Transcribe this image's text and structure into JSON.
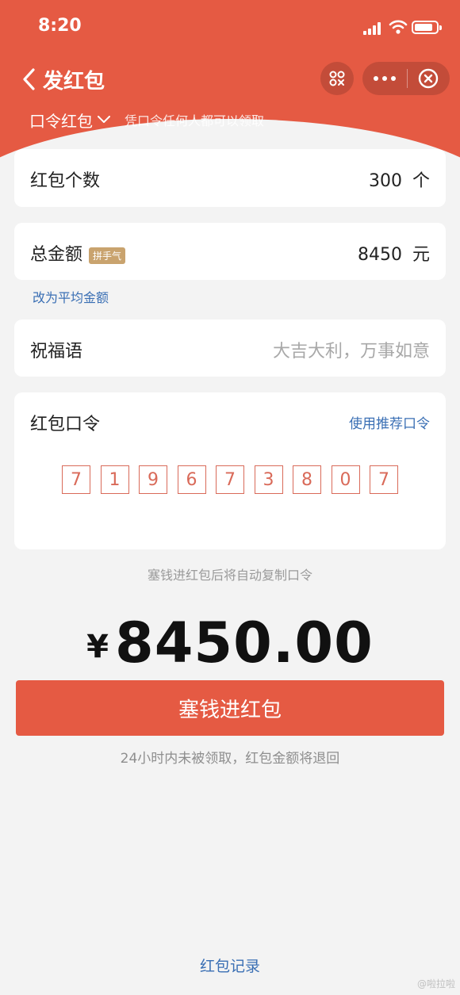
{
  "status_bar": {
    "time": "8:20",
    "icons": [
      "signal-icon",
      "wifi-icon",
      "battery-icon"
    ]
  },
  "nav": {
    "title": "发红包",
    "back_icon": "chevron-left-icon",
    "scan_icon": "scan-icon",
    "more_icon": "more-dots-icon",
    "close_icon": "close-circle-icon"
  },
  "packet_type": {
    "selected": "口令红包",
    "description": "凭口令任何人都可以领取"
  },
  "count_row": {
    "label": "红包个数",
    "value": "300",
    "unit": "个"
  },
  "total_row": {
    "label": "总金额",
    "badge": "拼手气",
    "value": "8450",
    "unit": "元"
  },
  "switch_link": "改为平均金额",
  "greeting_row": {
    "label": "祝福语",
    "placeholder": "大吉大利，万事如意"
  },
  "password_card": {
    "label": "红包口令",
    "recommend_link": "使用推荐口令",
    "digits": [
      "7",
      "1",
      "9",
      "6",
      "7",
      "3",
      "8",
      "0",
      "7"
    ]
  },
  "copy_hint": "塞钱进红包后将自动复制口令",
  "amount": {
    "currency": "¥",
    "value": "8450.00"
  },
  "submit_button": "塞钱进红包",
  "refund_note": "24小时内未被领取，红包金额将退回",
  "records_link": "红包记录",
  "watermark": "@啦拉啦",
  "colors": {
    "primary_red": "#e55a43",
    "link_blue": "#3a6fb4",
    "badge_gold": "#c9a36e",
    "background": "#f3f3f3"
  }
}
